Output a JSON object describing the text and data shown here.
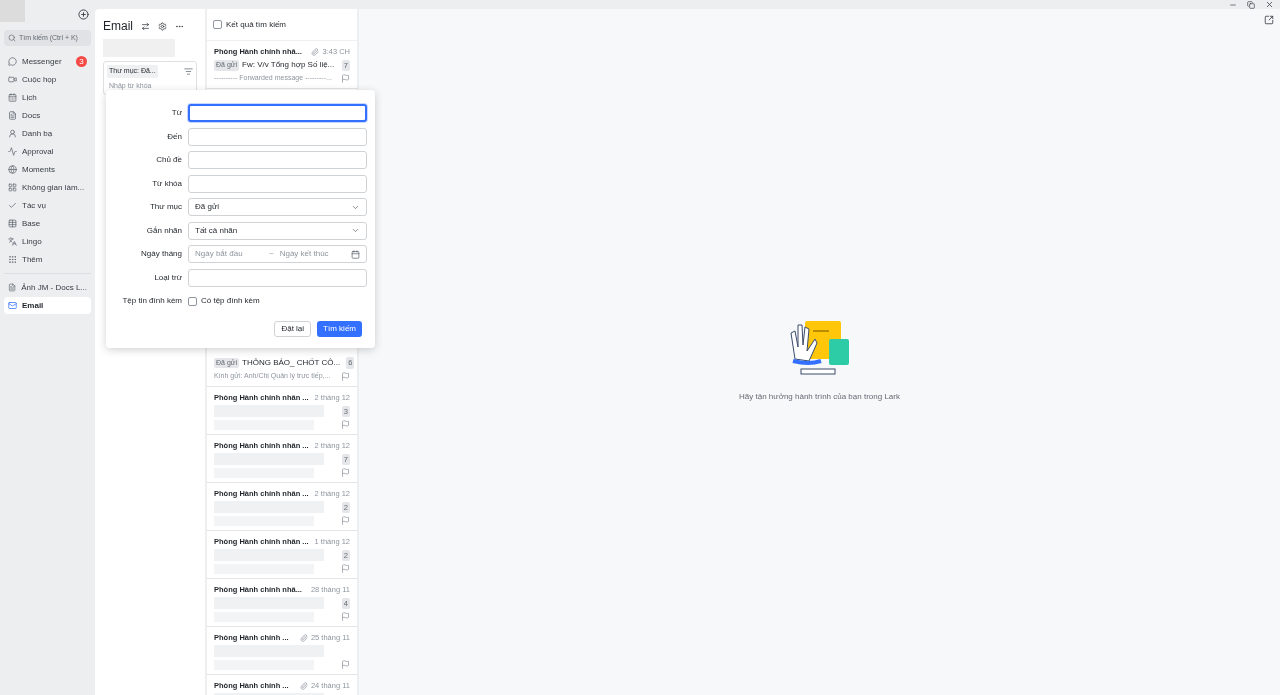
{
  "sidebar": {
    "search_placeholder": "Tìm kiếm (Ctrl + K)",
    "items": [
      {
        "label": "Messenger",
        "badge": "3",
        "selected": false
      },
      {
        "label": "Cuộc họp",
        "selected": false
      },
      {
        "label": "Lịch",
        "selected": false
      },
      {
        "label": "Docs",
        "selected": false
      },
      {
        "label": "Danh bạ",
        "selected": false
      },
      {
        "label": "Approval",
        "selected": false
      },
      {
        "label": "Moments",
        "selected": false
      },
      {
        "label": "Không gian làm...",
        "selected": false
      },
      {
        "label": "Tác vụ",
        "selected": false
      },
      {
        "label": "Base",
        "selected": false
      },
      {
        "label": "Lingo",
        "selected": false
      },
      {
        "label": "Thêm",
        "selected": false
      }
    ],
    "pinned": [
      {
        "label": "Ảnh JM - Docs L...",
        "selected": false
      },
      {
        "label": "Email",
        "selected": true
      }
    ]
  },
  "email_panel": {
    "title": "Email",
    "filter_chip": "Thư mục: Đã...",
    "search_placeholder": "Nhập từ khóa"
  },
  "search_form": {
    "fields": [
      {
        "label": "Từ",
        "kind": "text",
        "focused": true
      },
      {
        "label": "Đến",
        "kind": "text",
        "focused": false
      },
      {
        "label": "Chủ đề",
        "kind": "text",
        "focused": false
      },
      {
        "label": "Từ khóa",
        "kind": "text",
        "focused": false
      },
      {
        "label": "Thư mục",
        "kind": "select",
        "value": "Đã gửi",
        "focused": false
      },
      {
        "label": "Gắn nhãn",
        "kind": "select",
        "value": "Tất cả nhãn",
        "focused": false
      },
      {
        "label": "Ngày tháng",
        "kind": "date",
        "start_placeholder": "Ngày bắt đầu",
        "separator": "~",
        "end_placeholder": "Ngày kết thúc",
        "focused": false
      },
      {
        "label": "Loại trừ",
        "kind": "text",
        "focused": false
      },
      {
        "label": "Tệp tin đính kèm",
        "kind": "checkbox",
        "option": "Có tệp đính kèm",
        "checked": false
      }
    ],
    "buttons": [
      {
        "label": "Đặt lại",
        "primary": false
      },
      {
        "label": "Tìm kiếm",
        "primary": true
      }
    ]
  },
  "mail_list": {
    "header": {
      "label": "Kết quả tìm kiếm",
      "checked": false
    },
    "messages": [
      {
        "sender": "Phòng Hành chính nhâ...",
        "attachment": true,
        "date": "3:43 CH",
        "tag": "Đã gửi",
        "subject": "Fw: V/v Tổng hợp Số liệ...",
        "count": "7",
        "preview": "---------- Forwarded message ---------...",
        "redacted": false
      },
      {
        "attachment": false,
        "tag": "Đã gửi",
        "subject": "THÔNG BÁO_ CHỐT CÔ...",
        "count": "6",
        "preview": "Kính gửi: Anh/Chị Quản lý trực tiếp,...",
        "redacted": false
      },
      {
        "sender": "Phòng Hành chính nhân ...",
        "attachment": false,
        "date": "2 tháng 12",
        "count": "3",
        "redacted": true
      },
      {
        "sender": "Phòng Hành chính nhân ...",
        "attachment": false,
        "date": "2 tháng 12",
        "count": "7",
        "redacted": true
      },
      {
        "sender": "Phòng Hành chính nhân ...",
        "attachment": false,
        "date": "2 tháng 12",
        "count": "2",
        "redacted": true
      },
      {
        "sender": "Phòng Hành chính nhân ...",
        "attachment": false,
        "date": "1 tháng 12",
        "count": "2",
        "redacted": true
      },
      {
        "sender": "Phòng Hành chính nhâ...",
        "attachment": false,
        "date": "28 tháng 11",
        "count": "4",
        "redacted": true
      },
      {
        "sender": "Phòng Hành chính ...",
        "attachment": true,
        "date": "25 tháng 11",
        "redacted": true
      },
      {
        "sender": "Phòng Hành chính ...",
        "attachment": true,
        "date": "24 tháng 11",
        "redacted": true
      }
    ]
  },
  "empty_state": {
    "message": "Hãy tận hưởng hành trình của bạn trong Lark"
  }
}
